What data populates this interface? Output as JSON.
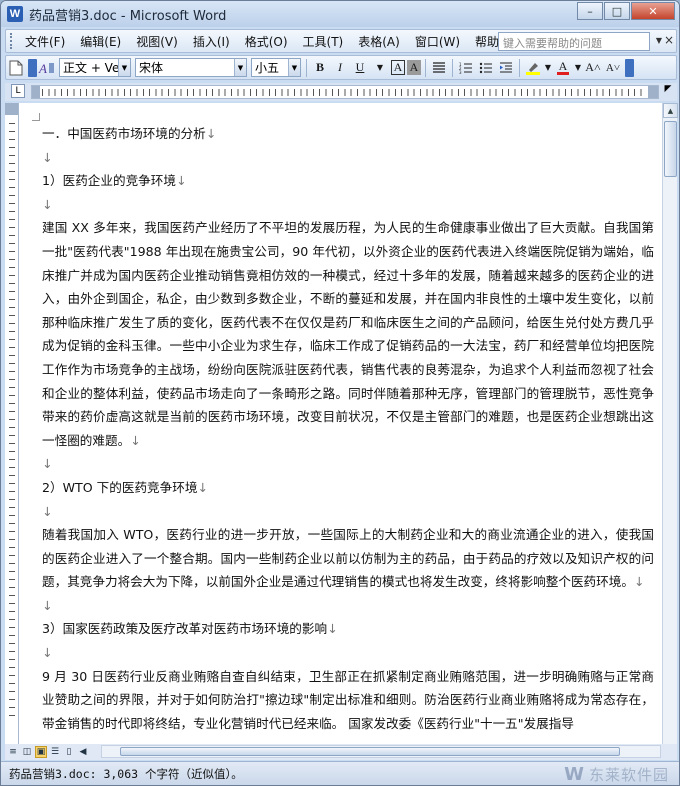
{
  "window": {
    "title": "药品营销3.doc - Microsoft Word",
    "app_icon": "W",
    "minimize": "–",
    "maximize": "□",
    "close": "✕"
  },
  "menu": {
    "items": [
      "文件(F)",
      "编辑(E)",
      "视图(V)",
      "插入(I)",
      "格式(O)",
      "工具(T)",
      "表格(A)",
      "窗口(W)",
      "帮助(H)"
    ],
    "help_placeholder": "键入需要帮助的问题",
    "close_doc": "×"
  },
  "toolbar": {
    "style_value": "正文 + Ver",
    "font_value": "宋体",
    "size_value": "小五",
    "bold": "B",
    "italic": "I",
    "underline": "U",
    "char_border": "A",
    "char_shade": "A",
    "grow_font": "A˄",
    "shrink_font": "A˅",
    "font_color": "A"
  },
  "colors": {
    "highlight": "#ffff00",
    "font_color": "#e02020",
    "title_bar": "#c9dcf2"
  },
  "ruler": {
    "tab_selector": "L"
  },
  "document": {
    "paragraphs": [
      {
        "text": "一．中国医药市场环境的分析",
        "mark": "↓"
      },
      {
        "text": "",
        "mark": "↓"
      },
      {
        "text": "1）医药企业的竞争环境",
        "mark": "↓"
      },
      {
        "text": "",
        "mark": "↓"
      },
      {
        "text": "建国 XX 多年来，我国医药产业经历了不平坦的发展历程，为人民的生命健康事业做出了巨大贡献。自我国第一批\"医药代表\"1988 年出现在施贵宝公司，90 年代初，以外资企业的医药代表进入终端医院促销为端始，临床推广并成为国内医药企业推动销售竟相仿效的一种模式，经过十多年的发展，随着越来越多的医药企业的进入，由外企到国企，私企，由少数到多数企业，不断的蔓延和发展，并在国内非良性的土壤中发生变化，以前那种临床推广发生了质的变化，医药代表不在仅仅是药厂和临床医生之间的产品顾问，给医生兑付处方费几乎成为促销的金科玉律。一些中小企业为求生存，临床工作成了促销药品的一大法宝，药厂和经营单位均把医院工作作为市场竞争的主战场，纷纷向医院派驻医药代表，销售代表的良莠混杂，为追求个人利益而忽视了社会和企业的整体利益，使药品市场走向了一条畸形之路。同时伴随着那种无序，管理部门的管理脱节，恶性竞争带来的药价虚高这就是当前的医药市场环境，改变目前状况，不仅是主管部门的难题，也是医药企业想跳出这一怪圈的难题。",
        "mark": "↓"
      },
      {
        "text": "",
        "mark": "↓"
      },
      {
        "text": "2）WTO 下的医药竞争环境",
        "mark": "↓"
      },
      {
        "text": "",
        "mark": "↓"
      },
      {
        "text": "随着我国加入 WTO，医药行业的进一步开放，一些国际上的大制药企业和大的商业流通企业的进入，使我国的医药企业进入了一个整合期。国内一些制药企业以前以仿制为主的药品，由于药品的疗效以及知识产权的问题，其竞争力将会大为下降，以前国外企业是通过代理销售的模式也将发生改变，终将影响整个医药环境。",
        "mark": "↓"
      },
      {
        "text": "",
        "mark": "↓"
      },
      {
        "text": "3）国家医药政策及医疗改革对医药市场环境的影响",
        "mark": "↓"
      },
      {
        "text": "",
        "mark": "↓"
      },
      {
        "text": "9 月 30 日医药行业反商业贿赂自查自纠结束，卫生部正在抓紧制定商业贿赂范围，进一步明确贿赂与正常商业赞助之间的界限，并对于如何防治打\"擦边球\"制定出标准和细则。防治医药行业商业贿赂将成为常态存在，带金销售的时代即将终结，专业化营销时代已经来临。 国家发改委《医药行业\"十一五\"发展指导",
        "mark": ""
      }
    ]
  },
  "status": {
    "text": "药品营销3.doc: 3,063 个字符（近似值）。",
    "watermark": "东莱软件园"
  }
}
